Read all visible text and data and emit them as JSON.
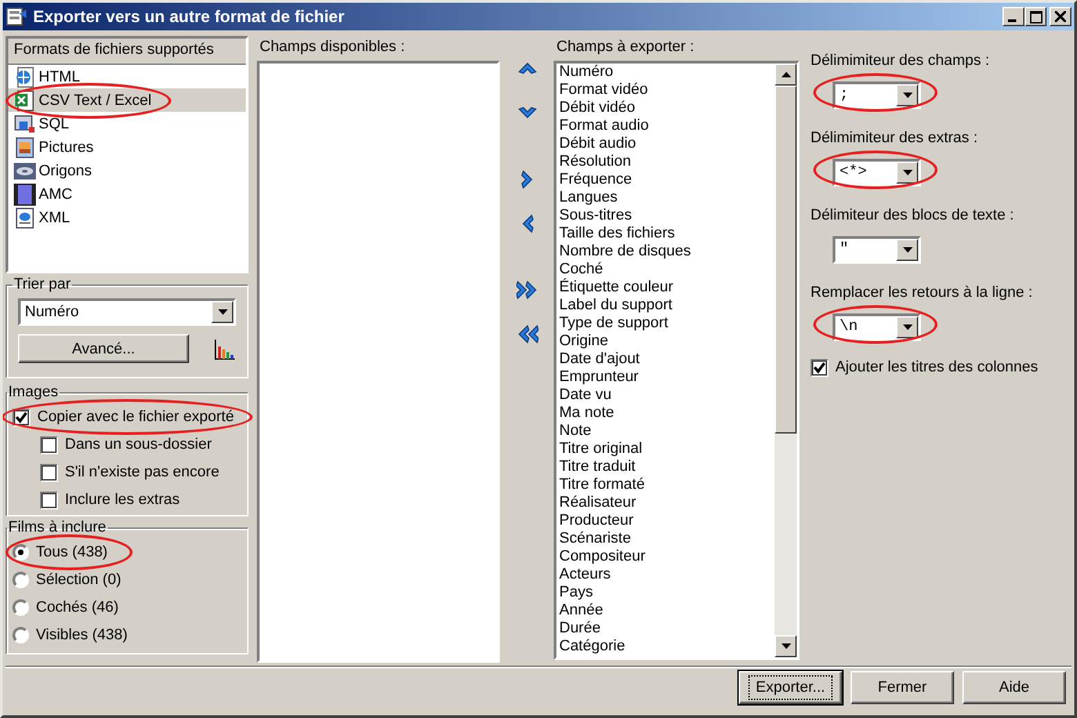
{
  "window": {
    "title": "Exporter vers un autre format de fichier"
  },
  "formats": {
    "header": "Formats de fichiers supportés",
    "items": [
      {
        "label": "HTML",
        "selected": false,
        "highlighted": false
      },
      {
        "label": "CSV Text / Excel",
        "selected": true,
        "highlighted": true
      },
      {
        "label": "SQL",
        "selected": false,
        "highlighted": false
      },
      {
        "label": "Pictures",
        "selected": false,
        "highlighted": false
      },
      {
        "label": "Origons",
        "selected": false,
        "highlighted": false
      },
      {
        "label": "AMC",
        "selected": false,
        "highlighted": false
      },
      {
        "label": "XML",
        "selected": false,
        "highlighted": false
      }
    ]
  },
  "sort": {
    "label": "Trier par",
    "value": "Numéro",
    "advanced_button": "Avancé..."
  },
  "images": {
    "label": "Images",
    "option": {
      "label": "Copier avec le fichier exporté",
      "checked": true,
      "highlighted": true,
      "children": [
        {
          "label": "Dans un sous-dossier",
          "checked": false
        },
        {
          "label": "S'il n'existe pas encore",
          "checked": false
        },
        {
          "label": "Inclure les extras",
          "checked": false
        }
      ]
    }
  },
  "films": {
    "label": "Films à inclure",
    "options": [
      {
        "label": "Tous (438)",
        "selected": true,
        "highlighted": true
      },
      {
        "label": "Sélection (0)",
        "selected": false,
        "highlighted": false
      },
      {
        "label": "Cochés (46)",
        "selected": false,
        "highlighted": false
      },
      {
        "label": "Visibles (438)",
        "selected": false,
        "highlighted": false
      }
    ]
  },
  "available": {
    "label": "Champs disponibles :"
  },
  "export_fields": {
    "label": "Champs à exporter :",
    "items": [
      "Numéro",
      "Format vidéo",
      "Débit vidéo",
      "Format audio",
      "Débit audio",
      "Résolution",
      "Fréquence",
      "Langues",
      "Sous-titres",
      "Taille des fichiers",
      "Nombre de disques",
      "Coché",
      "Étiquette couleur",
      "Label du support",
      "Type de support",
      "Origine",
      "Date d'ajout",
      "Emprunteur",
      "Date vu",
      "Ma note",
      "Note",
      "Titre original",
      "Titre traduit",
      "Titre formaté",
      "Réalisateur",
      "Producteur",
      "Scénariste",
      "Compositeur",
      "Acteurs",
      "Pays",
      "Année",
      "Durée",
      "Catégorie"
    ]
  },
  "delimiters": [
    {
      "label": "Délimimiteur des champs :",
      "value": ";",
      "highlighted": true
    },
    {
      "label": "Délimimiteur des extras :",
      "value": "<*>",
      "highlighted": true
    },
    {
      "label": "Délimiteur des blocs de texte :",
      "value": "\"",
      "highlighted": false
    },
    {
      "label": "Remplacer les retours à la ligne :",
      "value": "\\n",
      "highlighted": true
    }
  ],
  "add_titles": {
    "label": "Ajouter les titres des colonnes",
    "checked": true
  },
  "buttons": [
    {
      "label": "Exporter...",
      "default": true
    },
    {
      "label": "Fermer",
      "default": false
    },
    {
      "label": "Aide",
      "default": false
    }
  ]
}
